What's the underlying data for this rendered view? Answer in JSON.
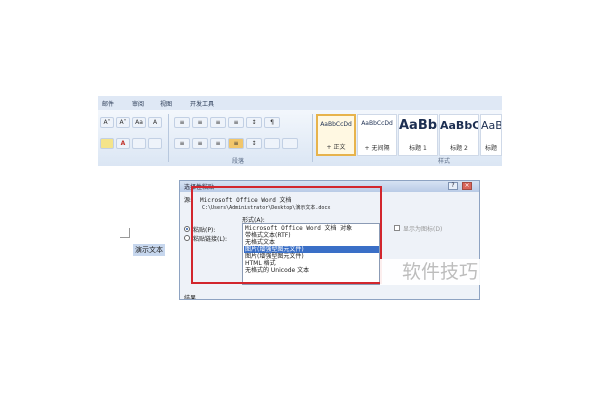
{
  "ribbon": {
    "tabs": [
      "邮件",
      "审阅",
      "视图",
      "开发工具"
    ],
    "font_buttons": [
      "A˄",
      "A˅",
      "Aa",
      "A"
    ],
    "paragraph_buttons": [
      "≡",
      "≡",
      "≡",
      "≡",
      "↕",
      "¶"
    ],
    "group_labels": {
      "paragraph": "段落",
      "styles": "样式"
    },
    "styles": [
      {
        "sample": "AaBbCcDd",
        "name": "+ 正文",
        "selected": true
      },
      {
        "sample": "AaBbCcDd",
        "name": "+ 无间隔",
        "selected": false
      },
      {
        "sample": "AaBb",
        "name": "标题 1",
        "selected": false
      },
      {
        "sample": "AaBbC",
        "name": "标题 2",
        "selected": false
      },
      {
        "sample": "AaBb",
        "name": "标题",
        "selected": false
      }
    ]
  },
  "document": {
    "selected_text": "演示文本"
  },
  "dialog": {
    "title": "选择性粘贴",
    "source_label": "源:",
    "source_app": "Microsoft Office Word 文档",
    "source_path": "C:\\Users\\Administrator\\Desktop\\演示文本.docx",
    "format_label": "形式(A):",
    "paste_label": "粘贴(P):",
    "paste_link_label": "粘贴链接(L):",
    "show_as_icon_label": "显示为图标(D)",
    "formats": [
      "Microsoft Office Word 文档 对象",
      "带格式文本(RTF)",
      "无格式文本",
      "图片(增强型图元文件)",
      "图片(增强型图元文件)",
      "HTML 格式",
      "无格式的 Unicode 文本"
    ],
    "selected_format_index": 3,
    "result_label": "结果",
    "controls": {
      "help": "?",
      "close": "×"
    }
  },
  "watermark": "软件技巧",
  "colors": {
    "highlight_box": "#d2262d",
    "selection": "#3a6fc7",
    "ribbon_bg": "#dbe6f4"
  }
}
